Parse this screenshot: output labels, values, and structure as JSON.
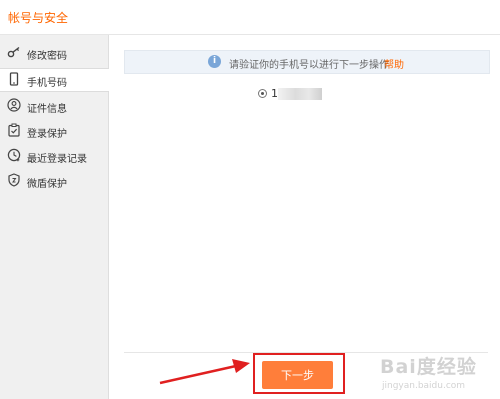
{
  "window": {
    "title": "帐号与安全"
  },
  "sidebar": {
    "items": [
      {
        "label": "修改密码",
        "icon": "key-icon",
        "active": false
      },
      {
        "label": "手机号码",
        "icon": "phone-icon",
        "active": true
      },
      {
        "label": "证件信息",
        "icon": "id-person-icon",
        "active": false
      },
      {
        "label": "登录保护",
        "icon": "clipboard-check-icon",
        "active": false
      },
      {
        "label": "最近登录记录",
        "icon": "clock-history-icon",
        "active": false
      },
      {
        "label": "微盾保护",
        "icon": "shield-icon",
        "active": false
      }
    ]
  },
  "main": {
    "notice": {
      "icon": "info-icon",
      "message": "请验证你的手机号以进行下一步操作",
      "help_link": "帮助"
    },
    "phone_option": {
      "number_prefix": "1",
      "selected": true
    },
    "next_button": {
      "label": "下一步"
    }
  },
  "annotations": {
    "arrow_color": "#e02020",
    "highlight_color": "#e02020"
  },
  "watermark": {
    "logo": "Bai度经验",
    "url": "jingyan.baidu.com"
  },
  "colors": {
    "accent": "#ff6600",
    "button": "#ff7e3a",
    "sidebar_bg": "#f0f0f0",
    "notice_bg": "#eef3f9",
    "info_icon": "#7aa6d8"
  }
}
